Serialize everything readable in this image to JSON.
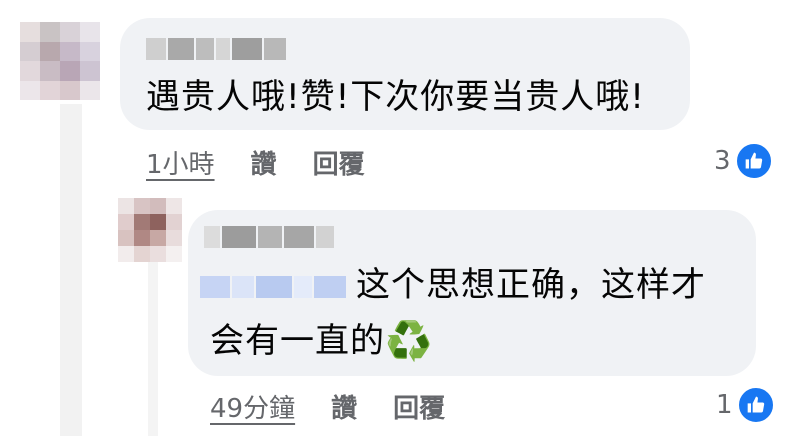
{
  "comments": [
    {
      "text": "遇贵人哦!赞!下次你要当贵人哦!",
      "time": "1小時",
      "like_label": "讚",
      "reply_label": "回覆",
      "reaction_count": "3",
      "reaction_icon": "like-icon"
    },
    {
      "text_line1": "这个思想正确，这样才",
      "text_line2": "会有一直的",
      "emoji": "♻️",
      "time": "49分鐘",
      "like_label": "讚",
      "reply_label": "回覆",
      "reaction_count": "1",
      "reaction_icon": "like-icon"
    }
  ],
  "colors": {
    "bubble": "#f0f2f5",
    "action_text": "#65676b",
    "like_badge": "#1877f2",
    "mention_blur": "#c9d7f5"
  }
}
